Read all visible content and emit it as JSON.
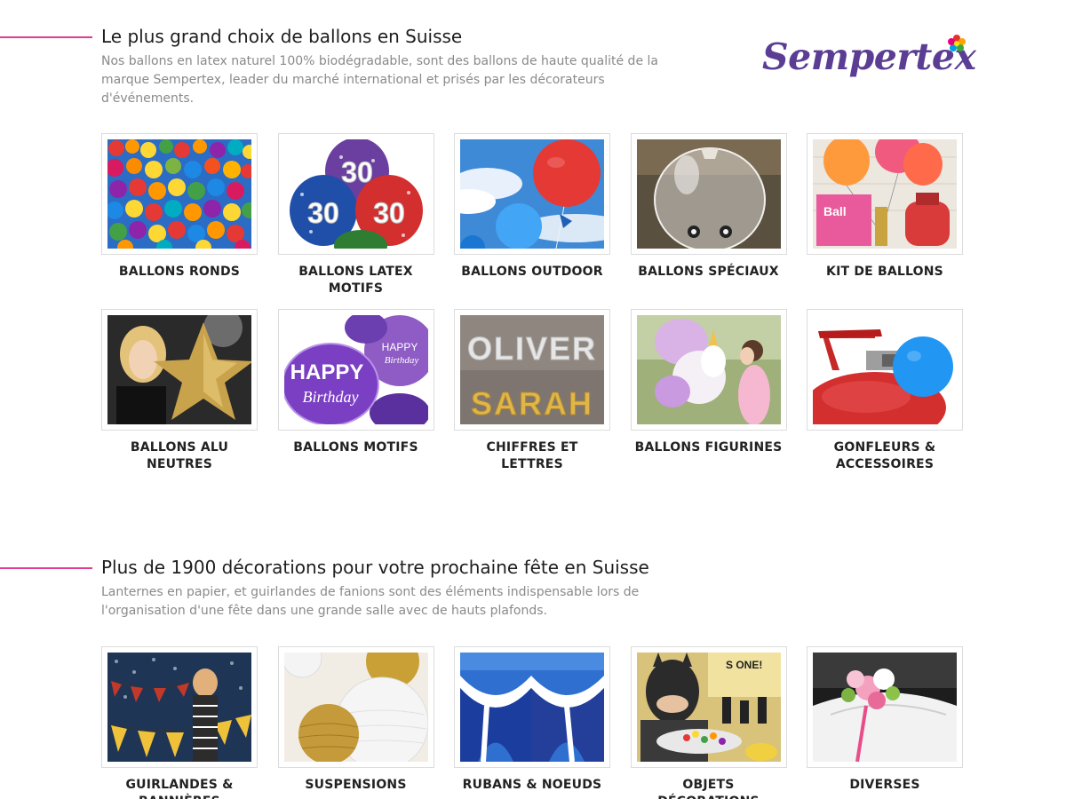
{
  "sections": [
    {
      "title": "Le plus grand choix de ballons en Suisse",
      "description": "Nos ballons en latex naturel 100% biodégradable, sont des ballons de haute qualité de la marque Sempertex, leader du marché international et prisés par les décorateurs d'événements.",
      "brand": {
        "name": "Sempertex",
        "color": "#5b3d94"
      },
      "categories": [
        {
          "label": "BALLONS RONDS",
          "image": "colorful-balloon-cloud"
        },
        {
          "label": "BALLONS LATEX MOTIFS",
          "image": "number-30-balloons"
        },
        {
          "label": "BALLONS OUTDOOR",
          "image": "red-balloon-sky"
        },
        {
          "label": "BALLONS SPÉCIAUX",
          "image": "clear-balloon"
        },
        {
          "label": "KIT DE BALLONS",
          "image": "balloon-kit-box"
        },
        {
          "label": "BALLONS ALU NEUTRES",
          "image": "woman-gold-star-balloon"
        },
        {
          "label": "BALLONS MOTIFS",
          "image": "happy-birthday-balloons"
        },
        {
          "label": "CHIFFRES ET LETTRES",
          "image": "letter-balloons-names"
        },
        {
          "label": "BALLONS FIGURINES",
          "image": "unicorn-balloon-girl"
        },
        {
          "label": "GONFLEURS & ACCESSOIRES",
          "image": "helium-tank"
        }
      ]
    },
    {
      "title": "Plus de 1900 décorations pour votre prochaine fête en Suisse",
      "description": "Lanternes en papier, et guirlandes de fanions sont des éléments indispensable lors de l'organisation d'une fête dans une grande salle avec de hauts plafonds.",
      "categories": [
        {
          "label": "GUIRLANDES & BANNIÈRES",
          "image": "bunting-woman"
        },
        {
          "label": "SUSPENSIONS",
          "image": "paper-lanterns"
        },
        {
          "label": "RUBANS & NOEUDS",
          "image": "fabric-drapes"
        },
        {
          "label": "OBJETS DÉCORATIONS",
          "image": "batman-party"
        },
        {
          "label": "DIVERSES",
          "image": "car-flower-bouquet"
        }
      ]
    }
  ],
  "colors": {
    "accent": "#e23b93",
    "text": "#1e1e1e",
    "muted": "#8a8a8a"
  }
}
